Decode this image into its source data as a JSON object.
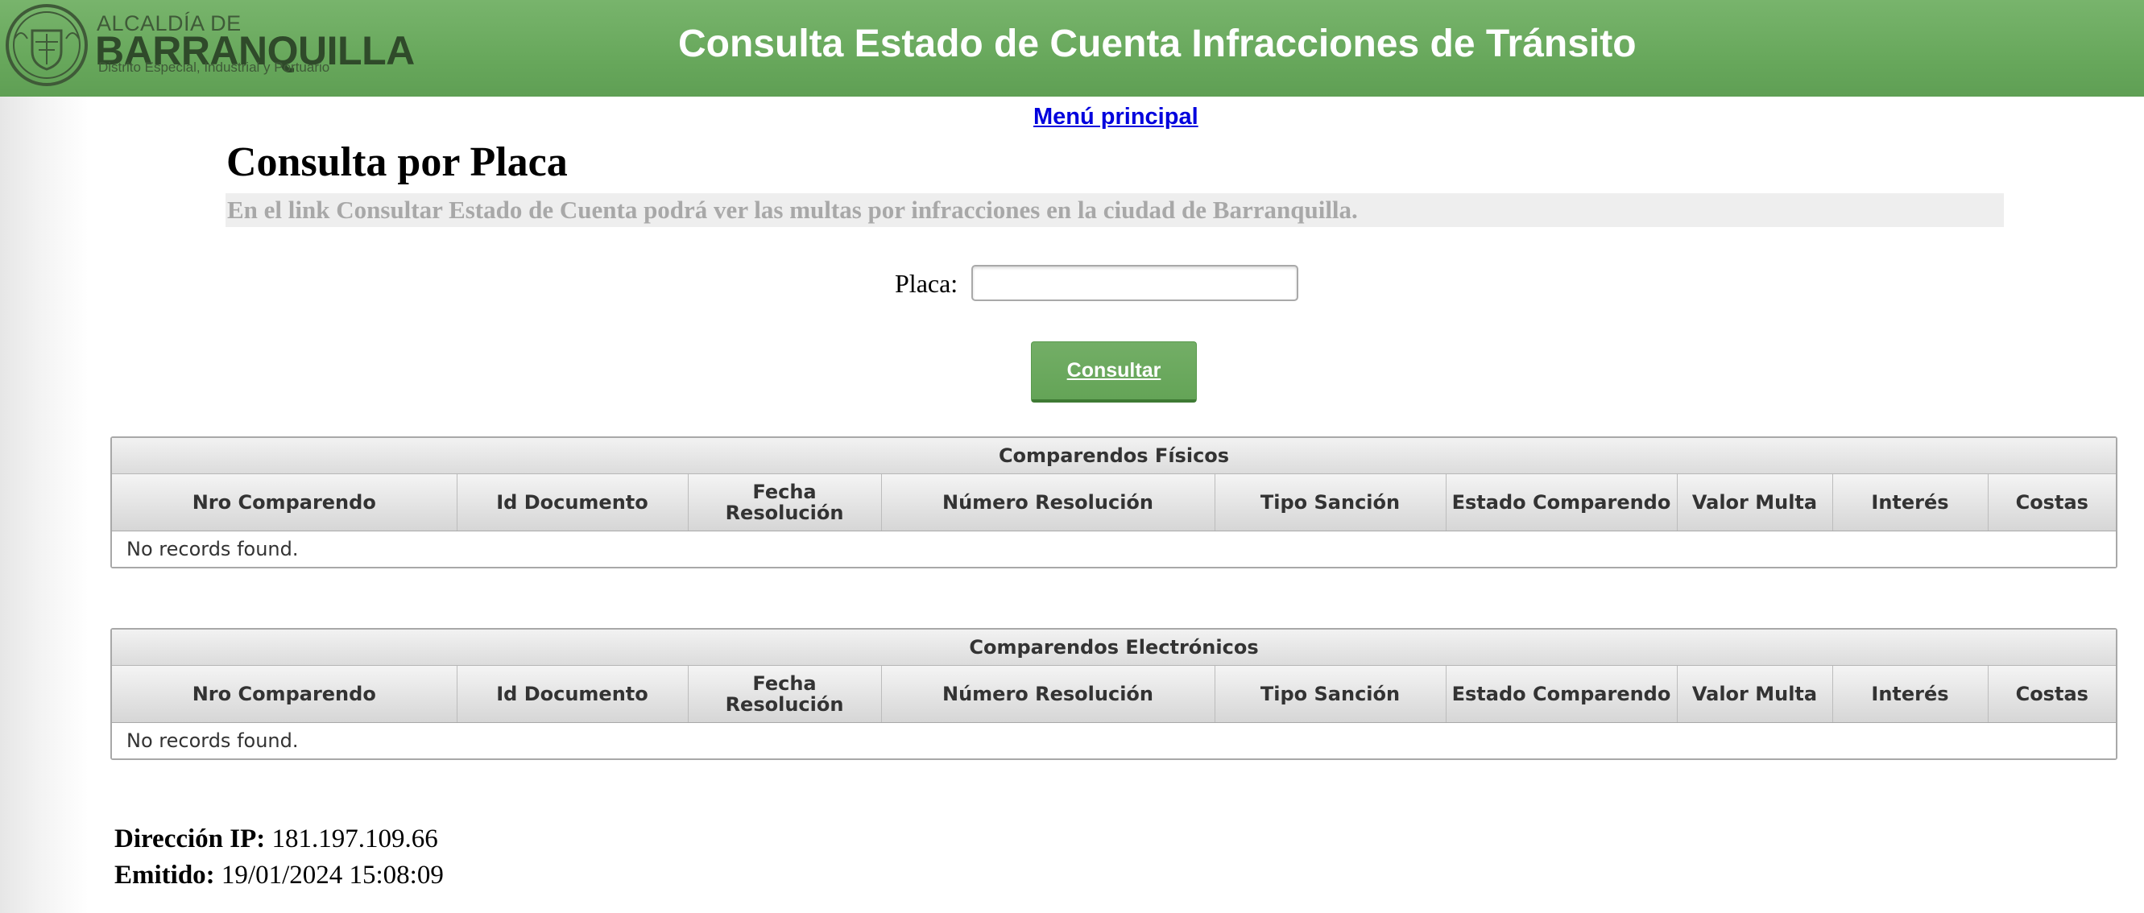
{
  "header": {
    "logo": {
      "line1": "ALCALDÍA DE",
      "line2": "BARRANQUILLA",
      "line3": "Distrito Especial, Industrial y Portuario"
    },
    "title": "Consulta Estado de Cuenta Infracciones de Tránsito"
  },
  "nav": {
    "menu_link": "Menú principal"
  },
  "main": {
    "title": "Consulta por Placa",
    "description": "En el link Consultar Estado de Cuenta podrá ver las multas por infracciones en la ciudad de Barranquilla.",
    "form": {
      "placa_label": "Placa:",
      "placa_value": "",
      "consultar_label": "Consultar"
    }
  },
  "tables": [
    {
      "caption": "Comparendos Físicos",
      "columns": [
        "Nro Comparendo",
        "Id Documento",
        "Fecha Resolución",
        "Número Resolución",
        "Tipo Sanción",
        "Estado Comparendo",
        "Valor Multa",
        "Interés",
        "Costas"
      ],
      "empty_message": "No records found."
    },
    {
      "caption": "Comparendos Electrónicos",
      "columns": [
        "Nro Comparendo",
        "Id Documento",
        "Fecha Resolución",
        "Número Resolución",
        "Tipo Sanción",
        "Estado Comparendo",
        "Valor Multa",
        "Interés",
        "Costas"
      ],
      "empty_message": "No records found."
    }
  ],
  "footer": {
    "ip_label": "Dirección IP:",
    "ip_value": "181.197.109.66",
    "emitido_label": "Emitido:",
    "emitido_value": "19/01/2024 15:08:09"
  },
  "colors": {
    "banner": "#6aa95e",
    "button": "#6aa95e",
    "link": "#0000dd"
  }
}
